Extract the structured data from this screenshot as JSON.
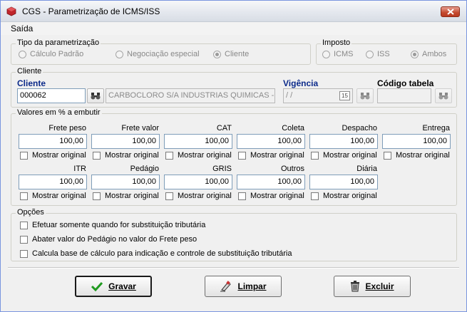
{
  "window": {
    "title": "CGS - Parametrização de ICMS/ISS"
  },
  "menu": {
    "items": [
      "Saída"
    ]
  },
  "tipo": {
    "legend": "Tipo da parametrização",
    "options": [
      "Cálculo Padrão",
      "Negociação especial",
      "Cliente"
    ],
    "selected": "Cliente"
  },
  "imposto": {
    "legend": "Imposto",
    "options": [
      "ICMS",
      "ISS",
      "Ambos"
    ],
    "selected": "Ambos"
  },
  "cliente": {
    "legend": "Cliente",
    "label": "Cliente",
    "code": "000062",
    "name": "CARBOCLORO S/A INDUSTRIAS QUIMICAS  -",
    "vigencia_label": "Vigência",
    "vigencia_value": " / /",
    "calendar_text": "15",
    "codigo_tabela_label": "Código tabela",
    "codigo_tabela_value": ""
  },
  "valores": {
    "legend": "Valores em % a embutir",
    "checkbox_label": "Mostrar original",
    "row1": [
      {
        "label": "Frete peso",
        "value": "100,00"
      },
      {
        "label": "Frete valor",
        "value": "100,00"
      },
      {
        "label": "CAT",
        "value": "100,00"
      },
      {
        "label": "Coleta",
        "value": "100,00"
      },
      {
        "label": "Despacho",
        "value": "100,00"
      },
      {
        "label": "Entrega",
        "value": "100,00"
      }
    ],
    "row2": [
      {
        "label": "ITR",
        "value": "100,00"
      },
      {
        "label": "Pedágio",
        "value": "100,00"
      },
      {
        "label": "GRIS",
        "value": "100,00"
      },
      {
        "label": "Outros",
        "value": "100,00"
      },
      {
        "label": "Diária",
        "value": "100,00"
      }
    ]
  },
  "opcoes": {
    "legend": "Opções",
    "items": [
      "Efetuar somente quando for substituição tributária",
      "Abater valor do Pedágio no valor do Frete peso",
      "Calcula base de cálculo para indicação e controle de substituição tributária"
    ]
  },
  "buttons": {
    "gravar": "Gravar",
    "limpar": "Limpar",
    "excluir": "Excluir"
  },
  "colors": {
    "label_blue": "#0b2a8a",
    "gravar_check": "#1f9a1f",
    "title_icon": "#c0262c"
  }
}
